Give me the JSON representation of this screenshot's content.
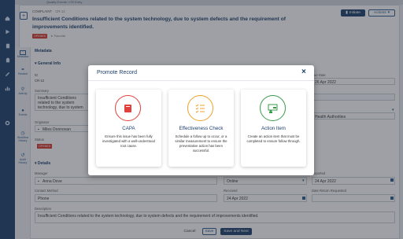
{
  "header": {
    "breadcrumb": "Quality Events / CR Entry",
    "type_label": "COMPLAINT",
    "record_id": "CR-12",
    "title": "Insufficient Conditions related to the system technology, due to system defects and the requirement of improvements identified.",
    "status_badge": "OPENED",
    "favorite_label": "Favorite",
    "initiate_label": "Initiate",
    "actions_label": "Actions"
  },
  "sidebar": {
    "items": [
      {
        "label": "Metadata"
      },
      {
        "label": "Related"
      },
      {
        "label": "Activity"
      },
      {
        "label": "Events"
      },
      {
        "label": "Workflow History"
      },
      {
        "label": "Audit History"
      }
    ]
  },
  "metadata": {
    "heading": "Metadata",
    "general_info": "General Info",
    "id_label": "ID",
    "id_value": "CR-12",
    "summary_label": "Summary",
    "summary_value": "Insufficient Conditions related to the system technology, due to system defects and the requirement of improvements identified.",
    "originator_label": "Originator",
    "originator_value": "Miles Donnovan",
    "status_label": "Status",
    "status_value": "OPENED",
    "due_label": "Due Date",
    "due_value": "26 Apr 2022",
    "authorities_value": "Health Authorities"
  },
  "details": {
    "heading": "Details",
    "manager_label": "Manager",
    "manager_value": "Anna Dove",
    "reporter_type_label": "Reporter Type",
    "reporter_type_value": "Online",
    "reported_label": "Reported",
    "reported_value": "24 Apr 2022",
    "contact_label": "Contact Method",
    "contact_value": "Phone",
    "received_label": "Received",
    "received_value": "24 Apr 2022",
    "return_label": "Date Return Requested",
    "description_label": "Description",
    "description_value": "Insufficient Conditions related to the system technology, due to system defects and the requirement of improvements identified."
  },
  "footer": {
    "cancel": "Cancel",
    "save": "Save",
    "save_next": "Save and Next"
  },
  "modal": {
    "title": "Promote Record",
    "close": "×",
    "options": [
      {
        "title": "CAPA",
        "desc": "Ensure this issue has been fully investigated with a well-understood root cause.",
        "color": "#e2413b"
      },
      {
        "title": "Effectiveness Check",
        "desc": "Schedule a follow up to occur, or a similar measurement to ensure the preventative action has been successful.",
        "color": "#f0a12b"
      },
      {
        "title": "Action Item",
        "desc": "Create an action item that must be completed to ensure follow through.",
        "color": "#3a9b4a"
      }
    ]
  },
  "colors": {
    "nav": "#1d3f6b",
    "accent": "#2b5a8c"
  }
}
